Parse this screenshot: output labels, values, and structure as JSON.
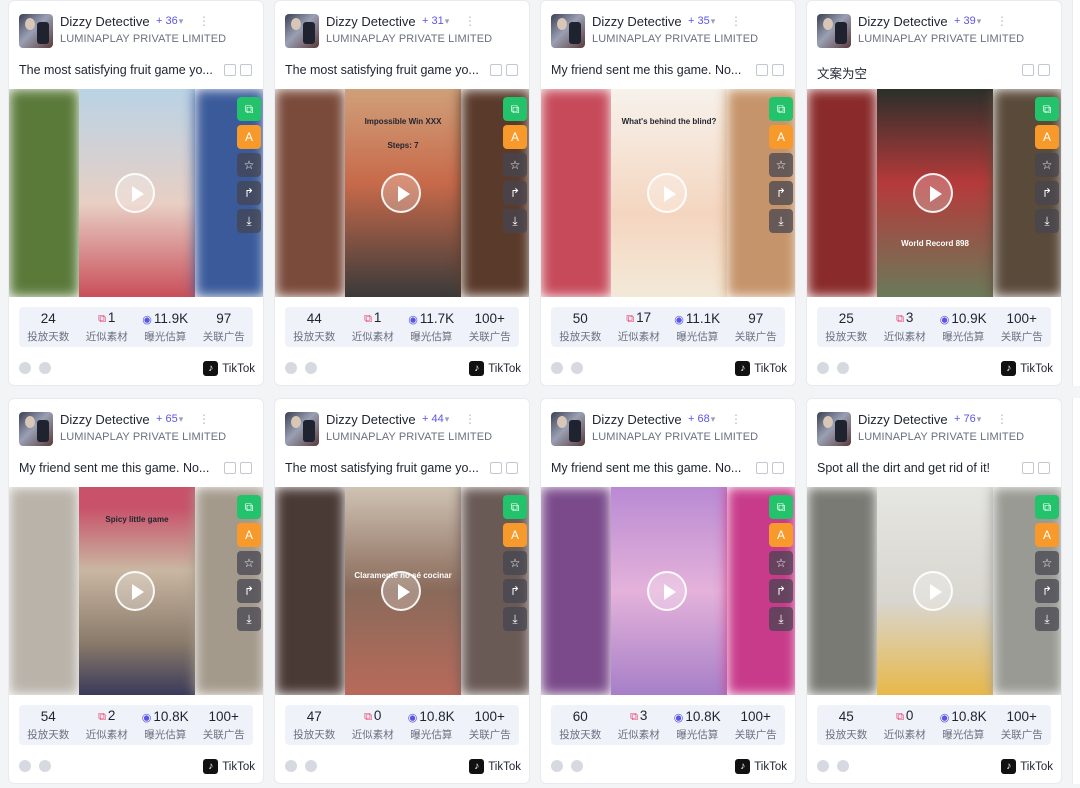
{
  "app": "Dizzy Detective",
  "company": "LUMINAPLAY PRIVATE LIMITED",
  "platform": "TikTok",
  "labels": {
    "days": "投放天数",
    "similar": "近似素材",
    "exposure": "曝光估算",
    "ads": "关联广告"
  },
  "icons": {
    "similar": "copy-icon",
    "exposure": "eye-icon",
    "play": "play-icon"
  },
  "colors": {
    "accent": "#5b55e6",
    "similar": "#ef3f6d",
    "green_btn": "#22c36a",
    "orange_btn": "#f7992b"
  },
  "cards": [
    {
      "plus": "+ 36",
      "caption": "The most satisfying fruit game yo...",
      "days": "24",
      "similar": "1",
      "exposure": "11.9K",
      "ads": "97",
      "overlay": []
    },
    {
      "plus": "+ 31",
      "caption": "The most satisfying fruit game yo...",
      "days": "44",
      "similar": "1",
      "exposure": "11.7K",
      "ads": "100+",
      "overlay": [
        "Impossible Win XXX",
        "Steps: 7"
      ]
    },
    {
      "plus": "+ 35",
      "caption": "My friend sent me this game. No...",
      "days": "50",
      "similar": "17",
      "exposure": "11.1K",
      "ads": "97",
      "overlay": [
        "What's behind the blind?"
      ]
    },
    {
      "plus": "+ 39",
      "caption": "文案为空",
      "days": "25",
      "similar": "3",
      "exposure": "10.9K",
      "ads": "100+",
      "overlay": [
        "World Record 898"
      ]
    },
    {
      "plus": "+ 65",
      "caption": "My friend sent me this game. No...",
      "days": "54",
      "similar": "2",
      "exposure": "10.8K",
      "ads": "100+",
      "overlay": [
        "Spicy little game"
      ]
    },
    {
      "plus": "+ 44",
      "caption": "The most satisfying fruit game yo...",
      "days": "47",
      "similar": "0",
      "exposure": "10.8K",
      "ads": "100+",
      "overlay": [
        "Claramente no sé cocinar"
      ]
    },
    {
      "plus": "+ 68",
      "caption": "My friend sent me this game. No...",
      "days": "60",
      "similar": "3",
      "exposure": "10.8K",
      "ads": "100+",
      "overlay": []
    },
    {
      "plus": "+ 76",
      "caption": "Spot all the dirt and get rid of it!",
      "days": "45",
      "similar": "0",
      "exposure": "10.8K",
      "ads": "100+",
      "overlay": []
    }
  ]
}
